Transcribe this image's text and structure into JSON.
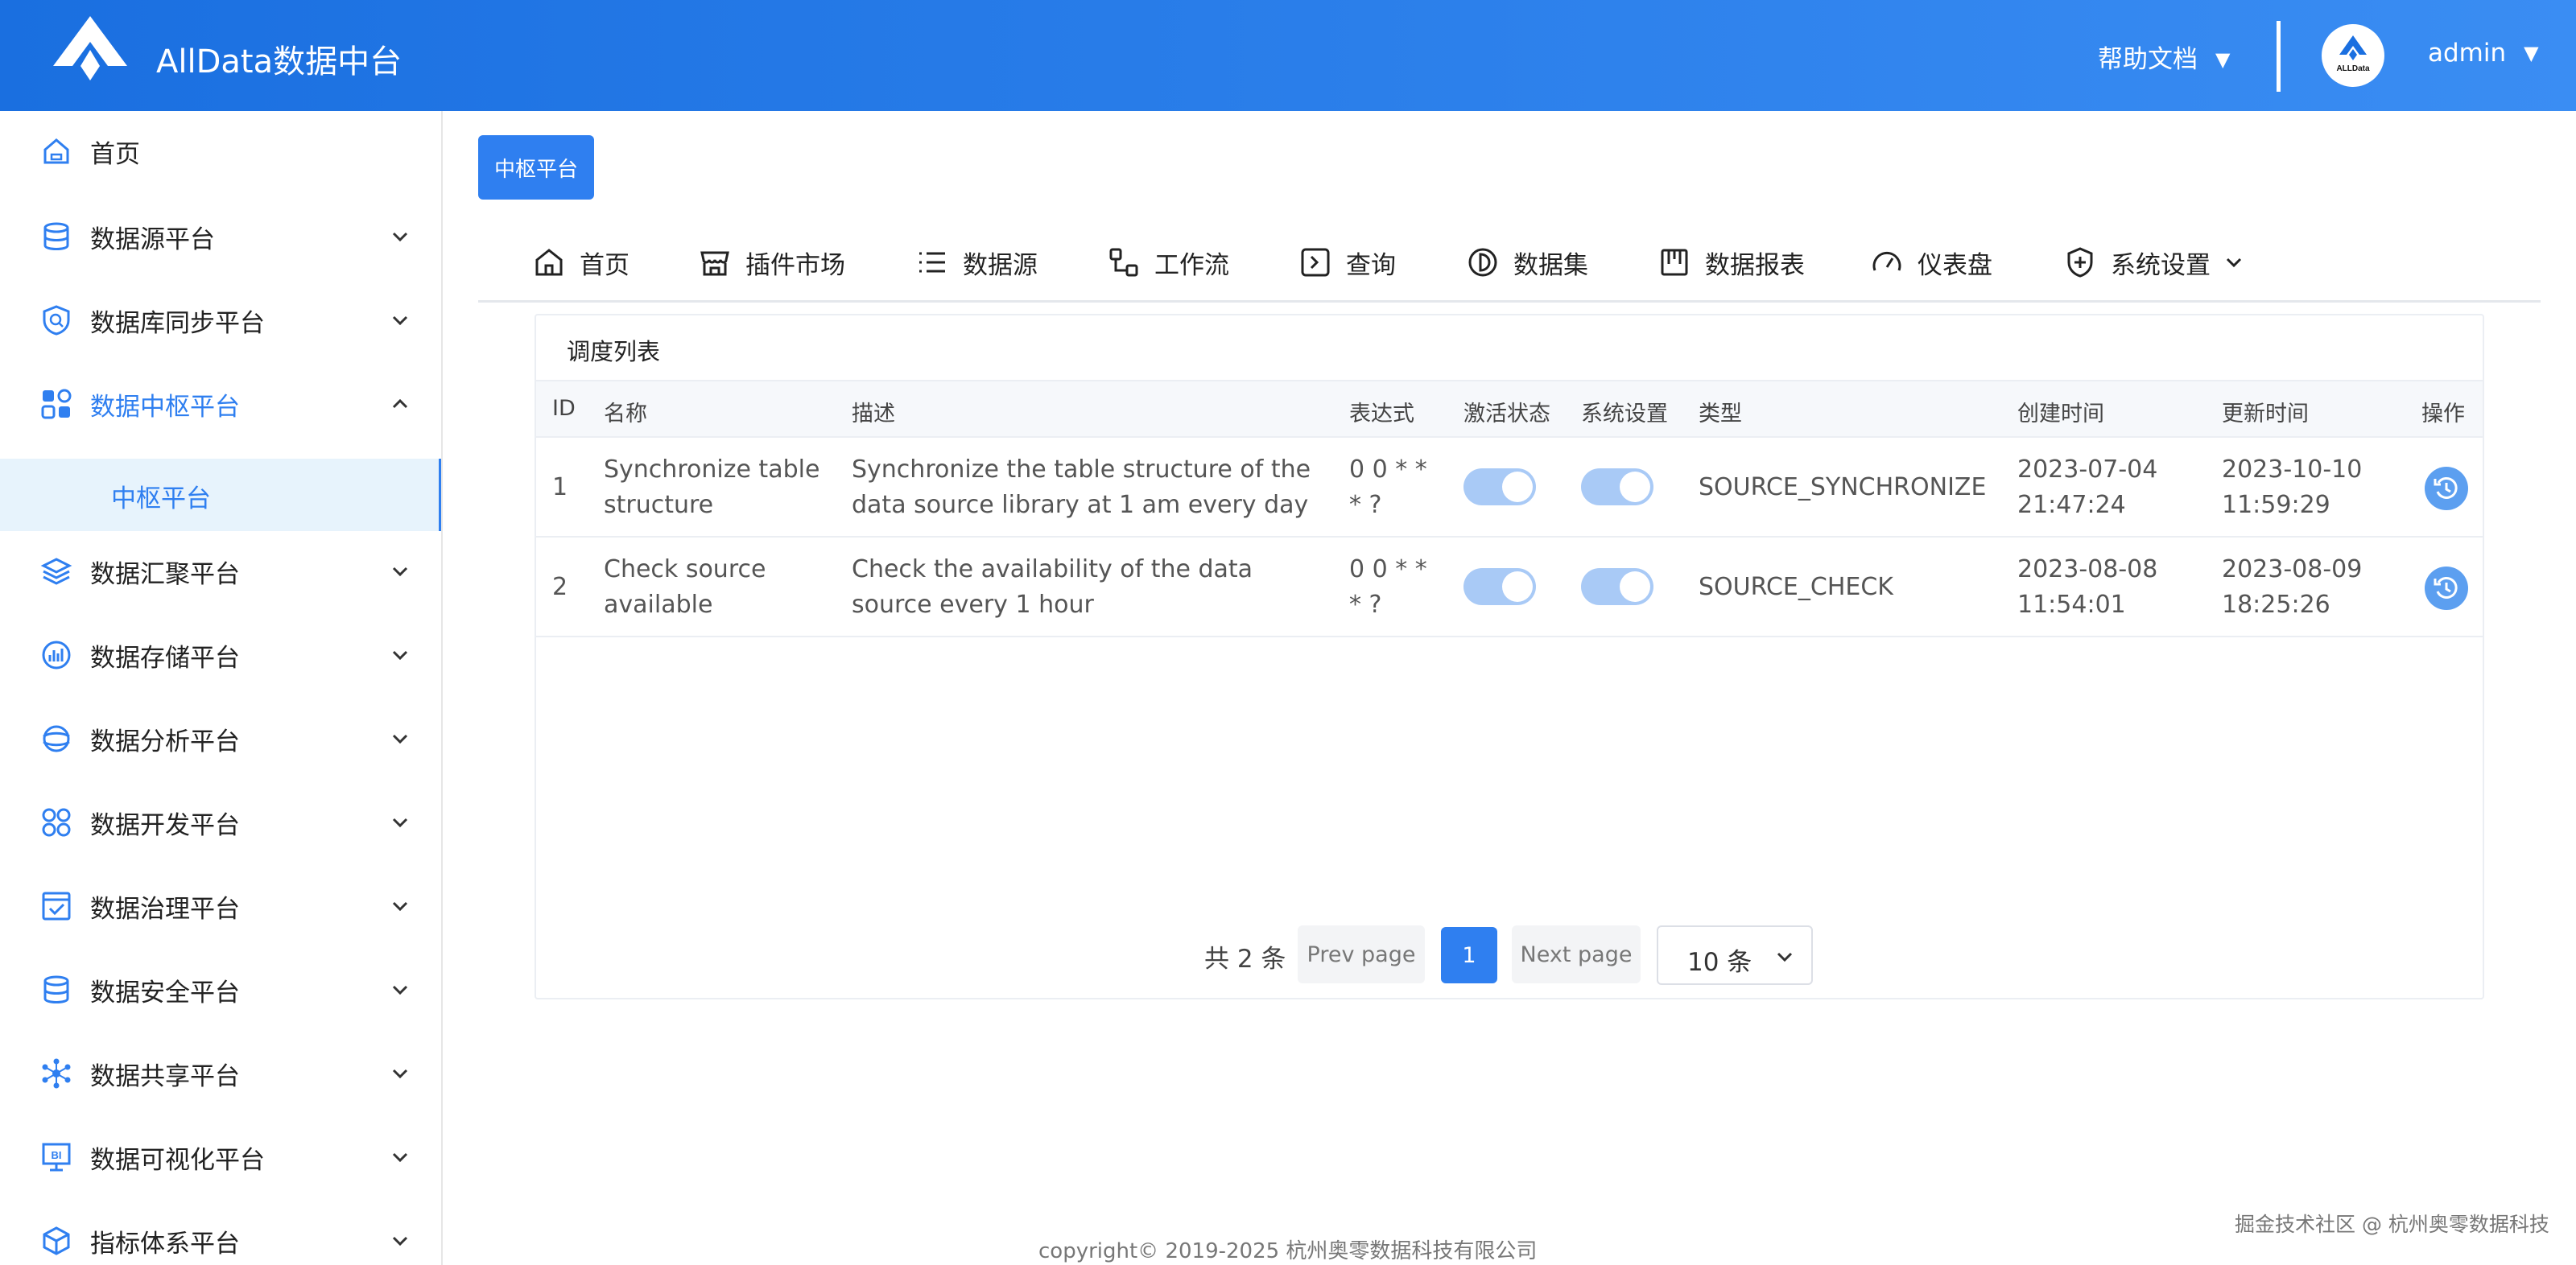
{
  "app": {
    "title": "AllData数据中台",
    "help_label": "帮助文档",
    "username": "admin",
    "avatar_text": "ALLData"
  },
  "sidebar": {
    "items": [
      {
        "label": "首页",
        "icon": "home-icon"
      },
      {
        "label": "数据源平台",
        "icon": "database-icon"
      },
      {
        "label": "数据库同步平台",
        "icon": "sync-shield-icon"
      },
      {
        "label": "数据中枢平台",
        "icon": "grid-icon",
        "expanded": true
      },
      {
        "label": "数据汇聚平台",
        "icon": "layers-icon"
      },
      {
        "label": "数据存储平台",
        "icon": "storage-chart-icon"
      },
      {
        "label": "数据分析平台",
        "icon": "analysis-icon"
      },
      {
        "label": "数据开发平台",
        "icon": "dev-circles-icon"
      },
      {
        "label": "数据治理平台",
        "icon": "governance-check-icon"
      },
      {
        "label": "数据安全平台",
        "icon": "security-db-icon"
      },
      {
        "label": "数据共享平台",
        "icon": "share-network-icon"
      },
      {
        "label": "数据可视化平台",
        "icon": "bi-screen-icon"
      },
      {
        "label": "指标体系平台",
        "icon": "metrics-box-icon"
      }
    ],
    "sub_item": "中枢平台"
  },
  "breadcrumb": {
    "label": "中枢平台"
  },
  "topnav": [
    {
      "label": "首页",
      "icon": "home-icon"
    },
    {
      "label": "插件市场",
      "icon": "store-icon"
    },
    {
      "label": "数据源",
      "icon": "list-icon"
    },
    {
      "label": "工作流",
      "icon": "workflow-icon"
    },
    {
      "label": "查询",
      "icon": "terminal-icon"
    },
    {
      "label": "数据集",
      "icon": "dataset-icon"
    },
    {
      "label": "数据报表",
      "icon": "report-icon"
    },
    {
      "label": "仪表盘",
      "icon": "gauge-icon"
    },
    {
      "label": "系统设置",
      "icon": "shield-plus-icon"
    }
  ],
  "table": {
    "title": "调度列表",
    "headers": [
      "ID",
      "名称",
      "描述",
      "表达式",
      "激活状态",
      "系统设置",
      "类型",
      "创建时间",
      "更新时间",
      "操作"
    ],
    "rows": [
      {
        "id": "1",
        "name": "Synchronize table structure",
        "desc": "Synchronize the table structure of the data source library at 1 am every day",
        "expr": "0 0 * * * ?",
        "active": true,
        "system": true,
        "type": "SOURCE_SYNCHRONIZE",
        "created": "2023-07-04 21:47:24",
        "updated": "2023-10-10 11:59:29"
      },
      {
        "id": "2",
        "name": "Check source available",
        "desc": "Check the availability of the data source every 1 hour",
        "expr": "0 0 * * * ?",
        "active": true,
        "system": true,
        "type": "SOURCE_CHECK",
        "created": "2023-08-08 11:54:01",
        "updated": "2023-08-09 18:25:26"
      }
    ]
  },
  "pagination": {
    "total": "共 2 条",
    "prev": "Prev page",
    "current": "1",
    "next": "Next page",
    "page_size": "10 条"
  },
  "footer": {
    "copyright": "copyright© 2019-2025 杭州奥零数据科技有限公司"
  },
  "watermark": "掘金技术社区 @ 杭州奥零数据科技",
  "colors": {
    "primary": "#2f7ff0",
    "header_start": "#1a6fe0",
    "header_end": "#3a8df3",
    "active_bg": "#e7f3fc",
    "toggle": "#a9caf6"
  }
}
